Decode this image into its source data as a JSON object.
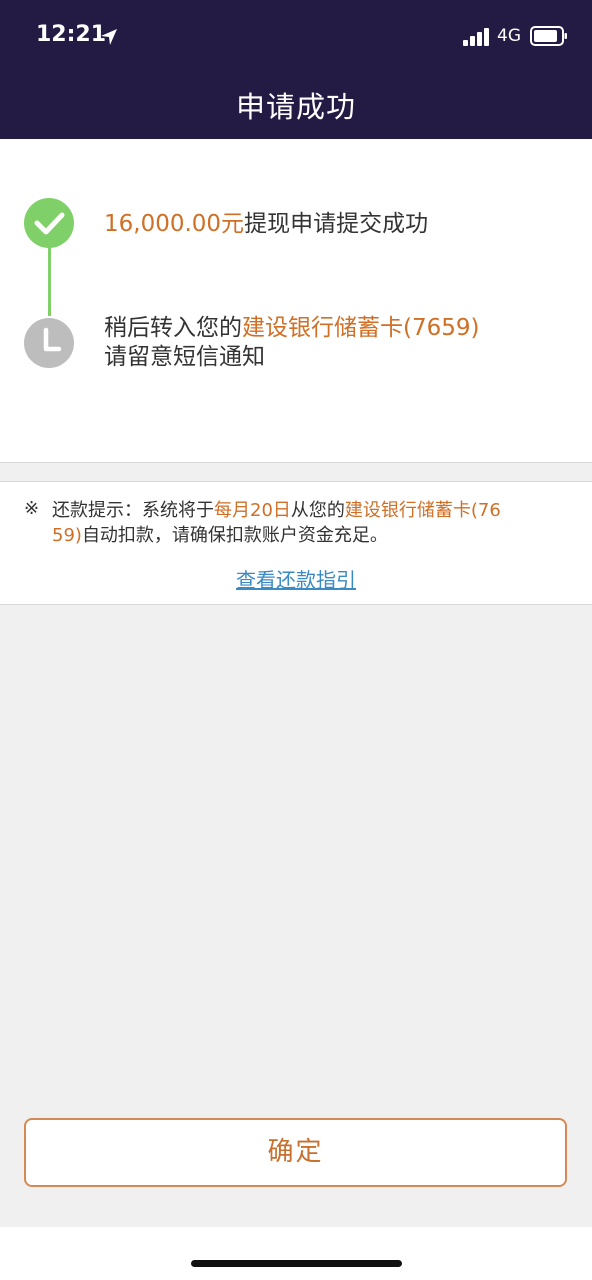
{
  "status_bar": {
    "time": "12:21",
    "network": "4G",
    "icons": [
      "location-arrow-icon",
      "signal-bars-icon",
      "battery-icon"
    ]
  },
  "nav": {
    "title": "申请成功"
  },
  "steps": {
    "step1": {
      "amount": "16,000.00元",
      "text": "提现申请提交成功",
      "icon": "check-icon",
      "color": "#7fd068"
    },
    "step2": {
      "prefix": "稍后转入您的",
      "card": "建设银行储蓄卡(7659)",
      "line2": "请留意短信通知",
      "icon": "clock-icon",
      "color": "#bdbdbd"
    }
  },
  "notice": {
    "mark": "※",
    "part1": "还款提示：系统将于",
    "date": "每月20日",
    "part2": "从您的",
    "card1": "建设银行储蓄卡(76",
    "card2": "59)",
    "part3": "自动扣款，请确保扣款账户资金充足。",
    "link": "查看还款指引"
  },
  "confirm_button": {
    "label": "确定"
  },
  "colors": {
    "header_bg": "#231b44",
    "accent_orange": "#d06f26",
    "link_blue": "#3a8ac4"
  }
}
